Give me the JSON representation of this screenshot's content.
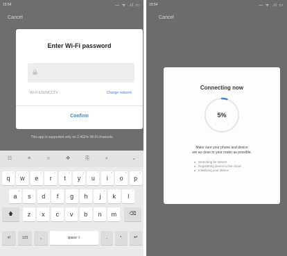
{
  "left": {
    "status_time": "15:54",
    "status_icons": "— ᯤ .ıl ▭",
    "cancel": "Cancel",
    "dialog": {
      "title": "Enter Wi-Fi password",
      "ssid": "Wi-Fi ESUNCCTV",
      "change_network": "Change network",
      "confirm": "Confirm"
    },
    "note": "This app is supported only on 2.4GHz Wi-Fi channels",
    "keyboard": {
      "toolbar": [
        "☷",
        "≡",
        "☺",
        "✥",
        "⎘",
        "⌕",
        "⌄"
      ],
      "row1": [
        {
          "k": "q",
          "h": "1"
        },
        {
          "k": "w",
          "h": "2"
        },
        {
          "k": "e",
          "h": "3"
        },
        {
          "k": "r",
          "h": "4"
        },
        {
          "k": "t",
          "h": "5"
        },
        {
          "k": "y",
          "h": "6"
        },
        {
          "k": "u",
          "h": "7"
        },
        {
          "k": "i",
          "h": "8"
        },
        {
          "k": "o",
          "h": "9"
        },
        {
          "k": "p",
          "h": "0"
        }
      ],
      "row2": [
        {
          "k": "a",
          "h": "@"
        },
        {
          "k": "s",
          "h": "*"
        },
        {
          "k": "d",
          "h": "+"
        },
        {
          "k": "f",
          "h": "-"
        },
        {
          "k": "g",
          "h": "="
        },
        {
          "k": "h",
          "h": "/"
        },
        {
          "k": "j",
          "h": "#"
        },
        {
          "k": "k",
          "h": "("
        },
        {
          "k": "l",
          "h": ")"
        }
      ],
      "row3": [
        {
          "k": "z",
          "h": "'"
        },
        {
          "k": "x",
          "h": ":"
        },
        {
          "k": "c",
          "h": "\""
        },
        {
          "k": "v",
          "h": "?"
        },
        {
          "k": "b",
          "h": "!"
        },
        {
          "k": "n",
          "h": "~"
        },
        {
          "k": "m",
          "h": "…"
        }
      ],
      "shift": "🡅",
      "backspace": "⌫",
      "symbols": "#/",
      "num": "123",
      "comma": ",",
      "space": "space ⇩",
      "period": ".",
      "punct": "*,",
      "enter": "↵"
    }
  },
  "right": {
    "status_time": "15:54",
    "status_icons": "— ᯤ .ıl ▭",
    "cancel": "Cancel",
    "dialog": {
      "title": "Connecting now",
      "percent_label": "5%",
      "progress": 0.05,
      "instruction_1": "Make sure your phone and device",
      "instruction_2": "are as close to your router as possible.",
      "steps": [
        "Searching for device",
        "Registering device to the cloud",
        "Initializing your device"
      ]
    }
  },
  "colors": {
    "accent": "#3d86d8",
    "overlay": "#6e6e6e"
  }
}
